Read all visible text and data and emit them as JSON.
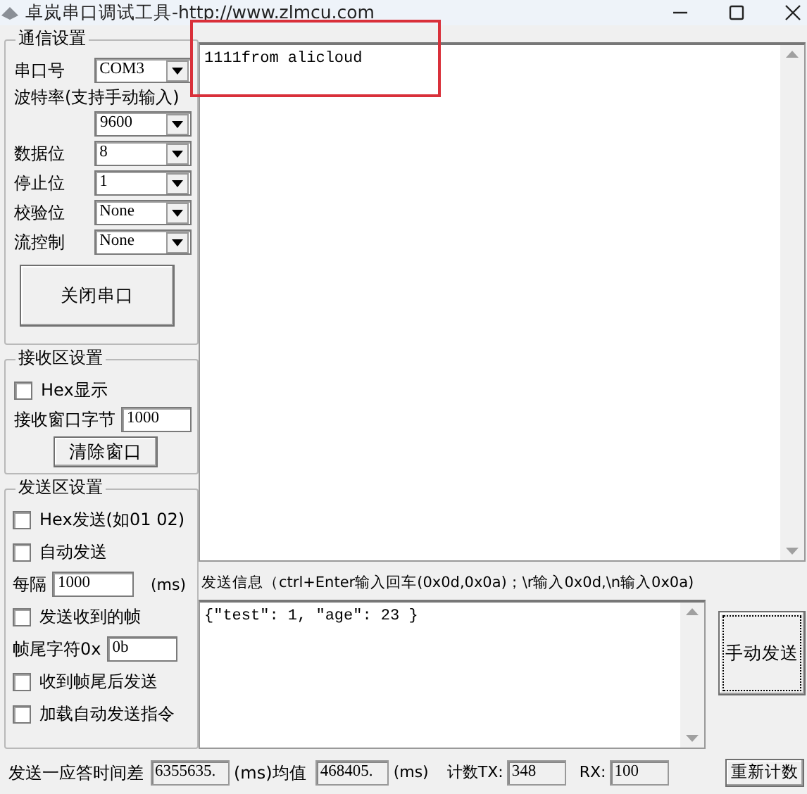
{
  "window": {
    "title": "卓岚串口调试工具-http://www.zlmcu.com"
  },
  "comm_settings": {
    "title": "通信设置",
    "fields": [
      {
        "kind": "inline",
        "label": "串口号",
        "value": "COM3"
      },
      {
        "kind": "stacked",
        "label": "波特率(支持手动输入)",
        "value": "9600"
      },
      {
        "kind": "inline",
        "label": "数据位",
        "value": "8"
      },
      {
        "kind": "inline",
        "label": "停止位",
        "value": "1"
      },
      {
        "kind": "inline",
        "label": "校验位",
        "value": "None"
      },
      {
        "kind": "inline",
        "label": "流控制",
        "value": "None"
      }
    ],
    "button": "关闭串口"
  },
  "receive_settings": {
    "title": "接收区设置",
    "items": [
      {
        "kind": "checkbox",
        "label": "Hex显示",
        "checked": false
      },
      {
        "kind": "input",
        "label": "接收窗口字节",
        "value": "1000"
      }
    ],
    "button": "清除窗口"
  },
  "send_settings": {
    "title": "发送区设置",
    "items": [
      {
        "kind": "checkbox",
        "label": "Hex发送(如01 02)",
        "checked": false
      },
      {
        "kind": "checkbox",
        "label": "自动发送",
        "checked": false
      },
      {
        "kind": "input",
        "label": "每隔",
        "value": "1000",
        "unit": "(ms)"
      },
      {
        "kind": "checkbox",
        "label": "发送收到的帧",
        "checked": false
      },
      {
        "kind": "input",
        "label": "帧尾字符0x",
        "value": "0b"
      },
      {
        "kind": "checkbox",
        "label": "收到帧尾后发送",
        "checked": false
      },
      {
        "kind": "checkbox",
        "label": "加载自动发送指令",
        "checked": false
      }
    ]
  },
  "receive_area": {
    "text": "1111from alicloud"
  },
  "send_area": {
    "label": "发送信息（ctrl+Enter输入回车(0x0d,0x0a)；\\r输入0x0d,\\n输入0x0a)",
    "text": "{\"test\": 1, \"age\": 23 }",
    "button": "手动发送"
  },
  "status_bar": {
    "latency_label": "发送一应答时间差",
    "latency": "6355635.",
    "latency_unit": "(ms)均值",
    "average": "468405.",
    "average_unit": "(ms)",
    "tx_label": "计数TX:",
    "tx": "348",
    "rx_label": "RX:",
    "rx": "100",
    "reset_button": "重新计数"
  }
}
